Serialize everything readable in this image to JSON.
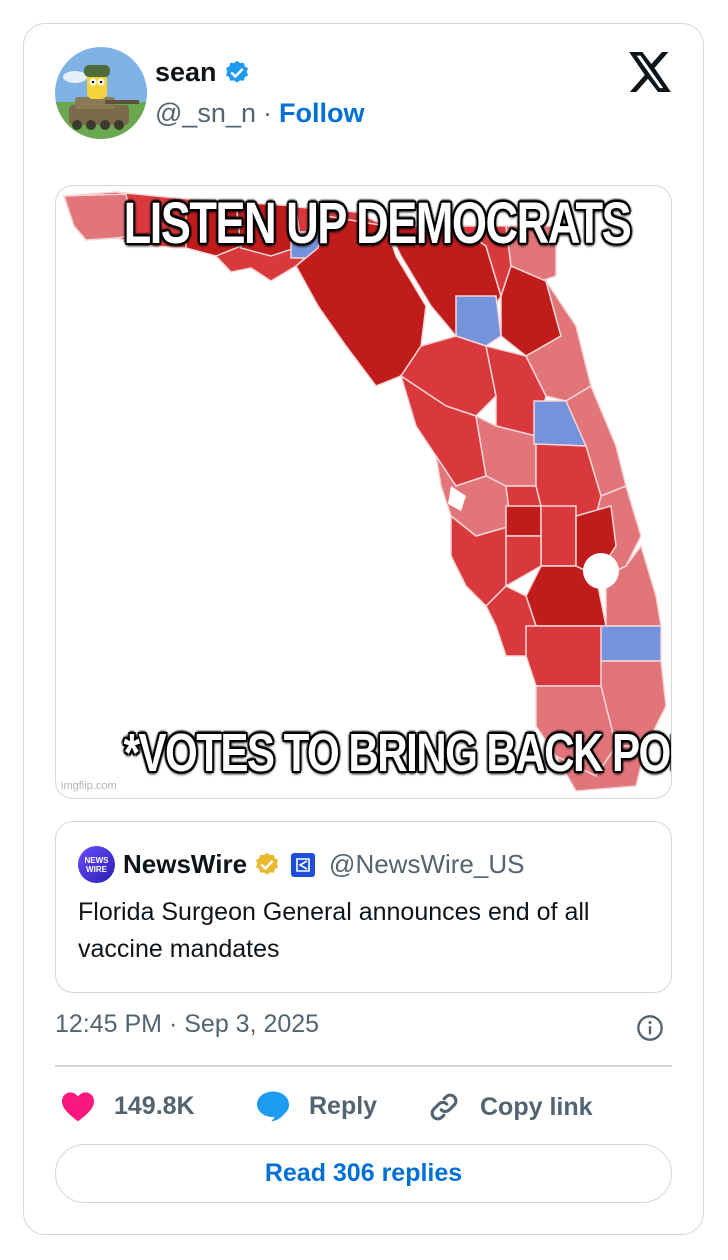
{
  "author": {
    "name": "sean",
    "handle": "@_sn_n",
    "separator": "·",
    "follow_label": "Follow",
    "verified_icon": "verified-badge-icon",
    "avatar_icon": "cartoon-avatar"
  },
  "platform_logo": "x-logo-icon",
  "media": {
    "top_text": "LISTEN UP DEMOCRATS",
    "bottom_text": "*VOTES TO BRING BACK POLIO*",
    "watermark": "imgflip.com"
  },
  "quoted_tweet": {
    "logo_text": "NEWS WIRE",
    "name": "NewsWire",
    "handle": "@NewsWire_US",
    "text": "Florida Surgeon General announces end of all vaccine mandates"
  },
  "timestamp": {
    "time": "12:45 PM",
    "separator": "·",
    "date": "Sep 3, 2025"
  },
  "actions": {
    "likes": "149.8K",
    "reply_label": "Reply",
    "copy_label": "Copy link"
  },
  "read_replies_label": "Read 306 replies",
  "colors": {
    "link_blue": "#006fd6",
    "like_pink": "#f91880",
    "reply_blue": "#1d9bf0",
    "map_red_dark": "#c01c1c",
    "map_red": "#d9383c",
    "map_red_light": "#e2757a",
    "map_blue": "#7592dc"
  }
}
